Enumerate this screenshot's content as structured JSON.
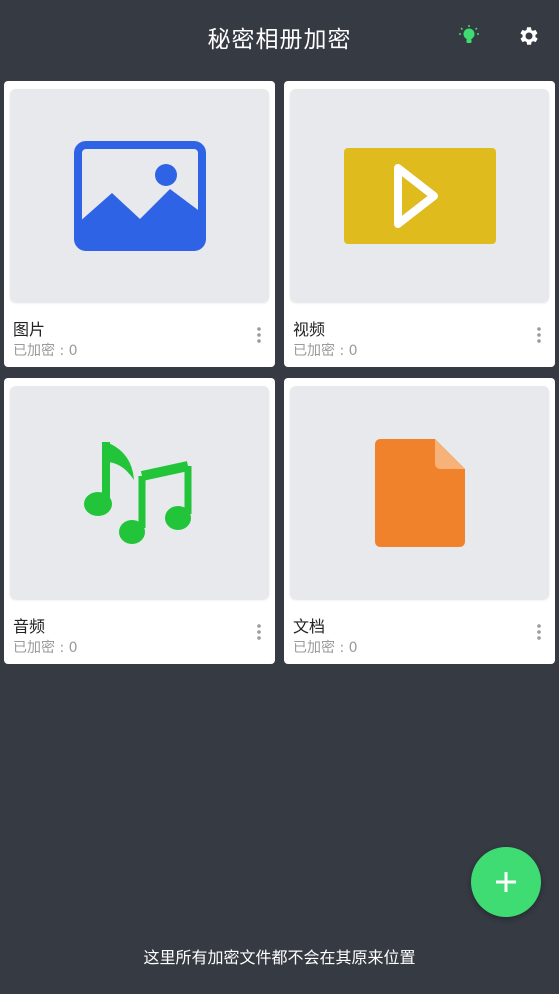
{
  "header": {
    "title": "秘密相册加密",
    "bulb_icon": "lightbulb-icon",
    "settings_icon": "gear-icon"
  },
  "cards": [
    {
      "name": "图片",
      "count": "已加密 : 0",
      "icon": "image-icon",
      "color": "#2f63e6"
    },
    {
      "name": "视频",
      "count": "已加密 : 0",
      "icon": "video-play-icon",
      "color": "#dfbb1e"
    },
    {
      "name": "音频",
      "count": "已加密 : 0",
      "icon": "music-note-icon",
      "color": "#22c43a"
    },
    {
      "name": "文档",
      "count": "已加密 : 0",
      "icon": "document-icon",
      "color": "#f0822b"
    }
  ],
  "fab": {
    "icon": "plus-icon",
    "color": "#3fdc73"
  },
  "footer": {
    "text": "这里所有加密文件都不会在其原来位置"
  }
}
